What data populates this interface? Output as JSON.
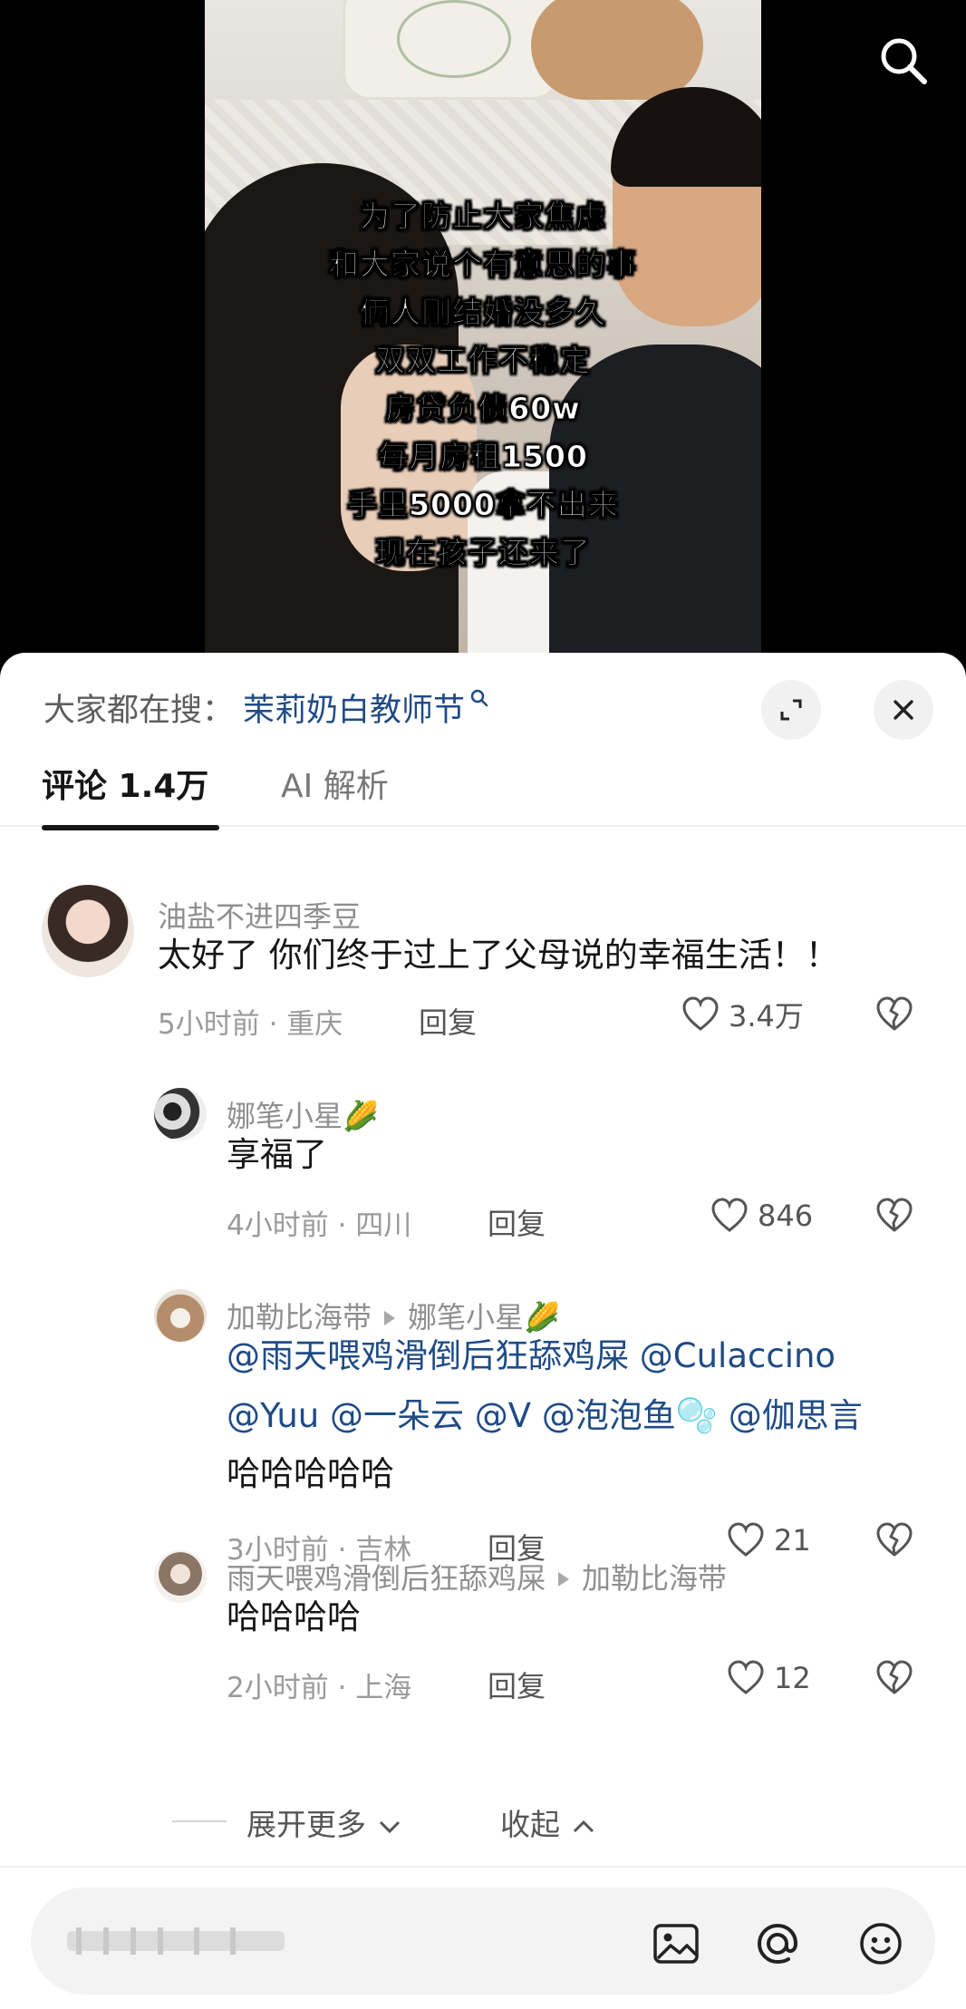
{
  "video": {
    "caption_lines": [
      "为了防止大家焦虑",
      "和大家说个有意思的事",
      "俩人刚结婚没多久",
      "双双工作不稳定",
      "房贷负债60w",
      "每月房租1500",
      "手里5000拿不出来",
      "现在孩子还来了"
    ]
  },
  "trending": {
    "label": "大家都在搜：",
    "term": "茉莉奶白教师节"
  },
  "tabs": {
    "comments": "评论 1.4万",
    "ai": "AI 解析"
  },
  "comments": [
    {
      "user": "油盐不进四季豆",
      "text": "太好了 你们终于过上了父母说的幸福生活！！",
      "time": "5小时前 · 重庆",
      "reply": "回复",
      "likes": "3.4万"
    },
    {
      "user": "娜笔小星🌽",
      "text": "享福了",
      "time": "4小时前 · 四川",
      "reply": "回复",
      "likes": "846"
    },
    {
      "user": "加勒比海带",
      "reply_to": "娜笔小星🌽",
      "line1_mentions": [
        "@雨天喂鸡滑倒后狂舔鸡屎",
        "@Culaccino"
      ],
      "line2_mentions": [
        "@Yuu",
        "@一朵云",
        "@V",
        "@泡泡鱼🫧",
        "@伽思言"
      ],
      "text": "哈哈哈哈哈",
      "time": "3小时前 · 吉林",
      "reply": "回复",
      "likes": "21"
    },
    {
      "user": "雨天喂鸡滑倒后狂舔鸡屎",
      "reply_to": "加勒比海带",
      "text": "哈哈哈哈",
      "time": "2小时前 · 上海",
      "reply": "回复",
      "likes": "12"
    }
  ],
  "thread_controls": {
    "expand_more": "展开更多",
    "collapse": "收起"
  },
  "colors": {
    "mention": "#1f4b86",
    "secondary_text": "#9a9a9a",
    "primary_text": "#161616"
  }
}
